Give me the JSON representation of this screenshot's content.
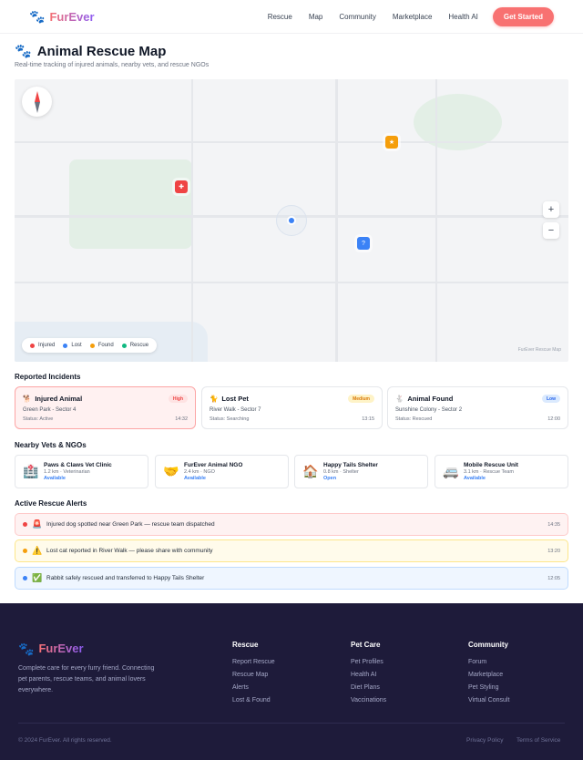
{
  "nav": {
    "brand": "FurEver",
    "links": [
      "Rescue",
      "Map",
      "Community",
      "Marketplace",
      "Health AI"
    ],
    "cta": "Get Started"
  },
  "page": {
    "title": "Animal Rescue Map",
    "subtitle": "Real-time tracking of injured animals, nearby vets, and rescue NGOs"
  },
  "map": {
    "zoom_in": "+",
    "zoom_out": "−",
    "legend": [
      {
        "label": "Injured",
        "color": "#ef4444"
      },
      {
        "label": "Lost",
        "color": "#3b82f6"
      },
      {
        "label": "Found",
        "color": "#f59e0b"
      },
      {
        "label": "Rescue",
        "color": "#10b981"
      }
    ],
    "credit": "FurEver Rescue Map",
    "marker_colors": {
      "injured": "#ef4444",
      "found": "#f59e0b",
      "lost": "#3b82f6"
    }
  },
  "incidents": {
    "heading": "Reported Incidents",
    "items": [
      {
        "icon": "🐕",
        "title": "Injured Animal",
        "badge": "High",
        "location": "Green Park - Sector 4",
        "status": "Status: Active",
        "time": "14:32"
      },
      {
        "icon": "🐈",
        "title": "Lost Pet",
        "badge": "Medium",
        "location": "River Walk - Sector 7",
        "status": "Status: Searching",
        "time": "13:15"
      },
      {
        "icon": "🐇",
        "title": "Animal Found",
        "badge": "Low",
        "location": "Sunshine Colony - Sector 2",
        "status": "Status: Rescued",
        "time": "12:00"
      }
    ]
  },
  "vets": {
    "heading": "Nearby Vets & NGOs",
    "items": [
      {
        "icon": "🏥",
        "name": "Paws & Claws Vet Clinic",
        "meta": "1.2 km · Veterinarian",
        "status": "Available"
      },
      {
        "icon": "🤝",
        "name": "FurEver Animal NGO",
        "meta": "2.4 km · NGO",
        "status": "Available"
      },
      {
        "icon": "🏠",
        "name": "Happy Tails Shelter",
        "meta": "0.8 km · Shelter",
        "status": "Open"
      },
      {
        "icon": "🚐",
        "name": "Mobile Rescue Unit",
        "meta": "3.1 km · Rescue Team",
        "status": "Available"
      }
    ]
  },
  "alerts": {
    "heading": "Active Rescue Alerts",
    "items": [
      {
        "icon": "🚨",
        "text": "Injured dog spotted near Green Park — rescue team dispatched",
        "time": "14:35"
      },
      {
        "icon": "⚠️",
        "text": "Lost cat reported in River Walk — please share with community",
        "time": "13:20"
      },
      {
        "icon": "✅",
        "text": "Rabbit safely rescued and transferred to Happy Tails Shelter",
        "time": "12:05"
      }
    ]
  },
  "footer": {
    "brand": "FurEver",
    "description": "Complete care for every furry friend. Connecting pet parents, rescue teams, and animal lovers everywhere.",
    "columns": [
      {
        "title": "Rescue",
        "links": [
          "Report Rescue",
          "Rescue Map",
          "Alerts",
          "Lost & Found"
        ]
      },
      {
        "title": "Pet Care",
        "links": [
          "Pet Profiles",
          "Health AI",
          "Diet Plans",
          "Vaccinations"
        ]
      },
      {
        "title": "Community",
        "links": [
          "Forum",
          "Marketplace",
          "Pet Styling",
          "Virtual Consult"
        ]
      }
    ],
    "copyright": "© 2024 FurEver. All rights reserved.",
    "privacy": "Privacy Policy",
    "terms": "Terms of Service"
  }
}
